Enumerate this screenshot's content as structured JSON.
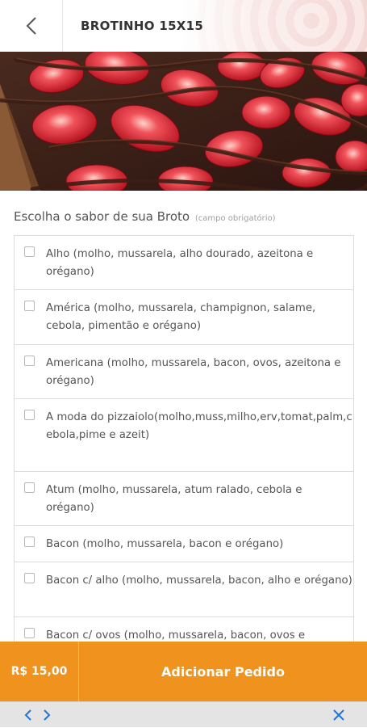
{
  "header": {
    "title": "BROTINHO 15X15",
    "back_icon": "chevron-left-icon"
  },
  "hero": {
    "image": "strawberry-chocolate-pizza"
  },
  "section": {
    "label": "Escolha o sabor de sua Broto",
    "hint": "(campo obrigatório)"
  },
  "options": [
    {
      "label": "Alho (molho, mussarela, alho dourado, azeitona e orégano)"
    },
    {
      "label": "América (molho, mussarela, champignon, salame, cebola, pimentão e orégano)"
    },
    {
      "label": "Americana (molho, mussarela, bacon, ovos, azeitona e orégano)"
    },
    {
      "label": "A moda do pizzaiolo(molho,muss,milho,erv,tomat,palm,cebola,pime e azeit)"
    },
    {
      "label": "Atum (molho, mussarela, atum ralado, cebola e orégano)"
    },
    {
      "label": "Bacon (molho, mussarela, bacon e orégano)"
    },
    {
      "label": "Bacon c/ alho (molho, mussarela, bacon, alho e orégano)"
    },
    {
      "label": "Bacon c/ ovos (molho, mussarela, bacon, ovos e"
    }
  ],
  "order": {
    "price": "R$ 15,00",
    "add_label": "Adicionar Pedido"
  },
  "nav": {
    "back_icon": "chevron-left-icon",
    "forward_icon": "chevron-right-icon",
    "close_icon": "close-icon"
  },
  "colors": {
    "accent": "#f0921e",
    "border": "#dcdcdc",
    "text": "#555555"
  }
}
